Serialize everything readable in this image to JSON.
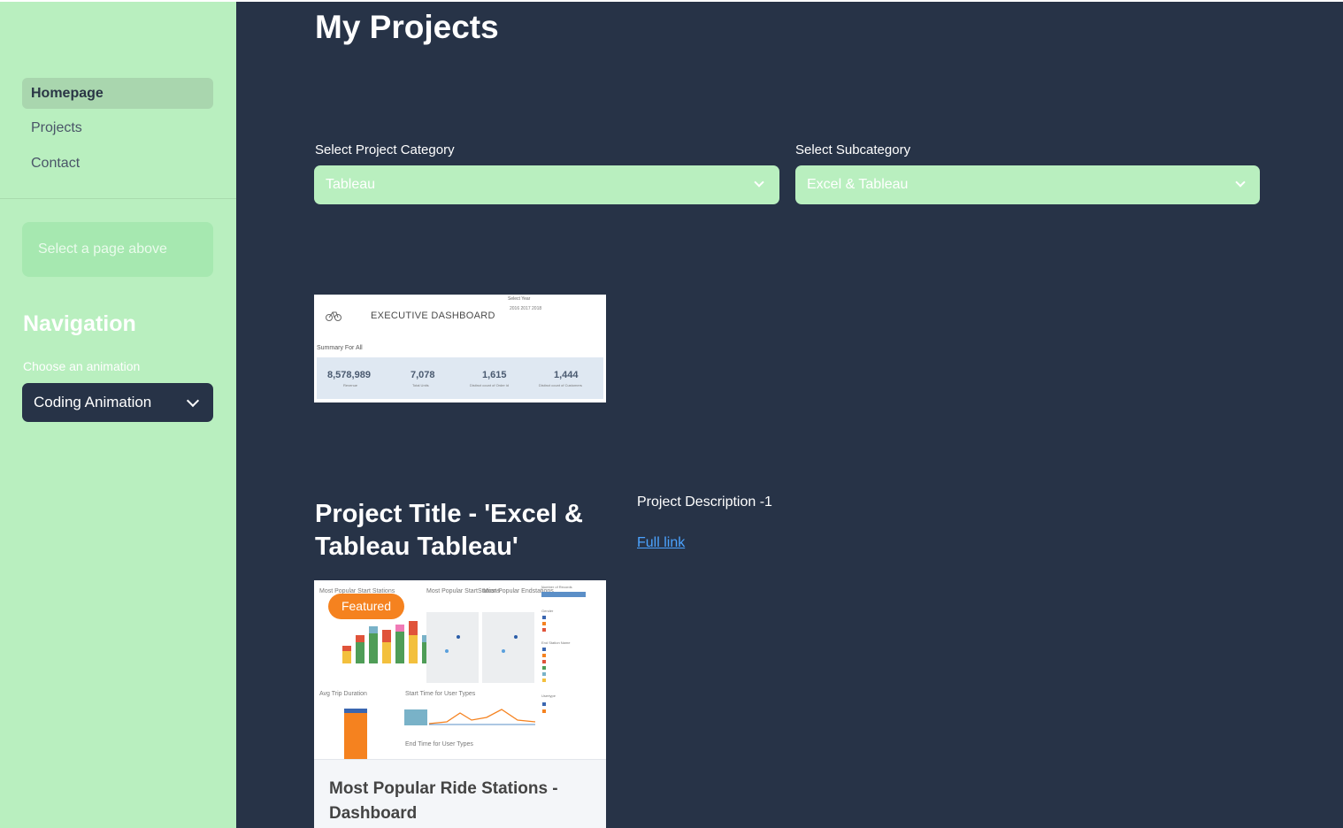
{
  "sidebar": {
    "nav_items": [
      {
        "label": "Homepage",
        "active": true
      },
      {
        "label": "Projects",
        "active": false
      },
      {
        "label": "Contact",
        "active": false
      }
    ],
    "hint": "Select a page above",
    "navigation_heading": "Navigation",
    "animation_label": "Choose an animation",
    "animation_selected": "Coding Animation"
  },
  "main": {
    "title": "My Projects",
    "category_label": "Select Project Category",
    "category_value": "Tableau",
    "subcategory_label": "Select Subcategory",
    "subcategory_value": "Excel & Tableau",
    "thumbnail": {
      "header": "EXECUTIVE DASHBOARD",
      "year_label": "Select Year",
      "years": "2016  2017  2018",
      "summary_label": "Summary For All",
      "kpis": [
        {
          "value": "8,578,989",
          "label": "Revenue"
        },
        {
          "value": "7,078",
          "label": "Total Units"
        },
        {
          "value": "1,615",
          "label": "Distinct count of Order id"
        },
        {
          "value": "1,444",
          "label": "Distinct count of Customers"
        }
      ]
    },
    "project": {
      "title": "Project Title - 'Excel & Tableau Tableau'",
      "description": "Project Description -1",
      "link_text": "Full link"
    },
    "card": {
      "badge": "Featured",
      "title": "Most Popular Ride Stations - Dashboard",
      "chart_labels": {
        "start_stations": "Most Popular Start Stations",
        "start_stations_short": "Most Popular StartStations",
        "end_stations": "Most Popular Endstations",
        "avg_trip": "Avg Trip Duration",
        "start_time": "Start Time for User Types",
        "end_time": "End Time for User Types",
        "number_of_records": "Number of Records",
        "end_station_name": "End Station Name",
        "usertype": "Usertype",
        "gender": "Gender"
      }
    }
  },
  "colors": {
    "sidebar_bg": "#b9efbf",
    "main_bg": "#273347",
    "badge": "#f5821f",
    "link": "#4ba3ff"
  }
}
